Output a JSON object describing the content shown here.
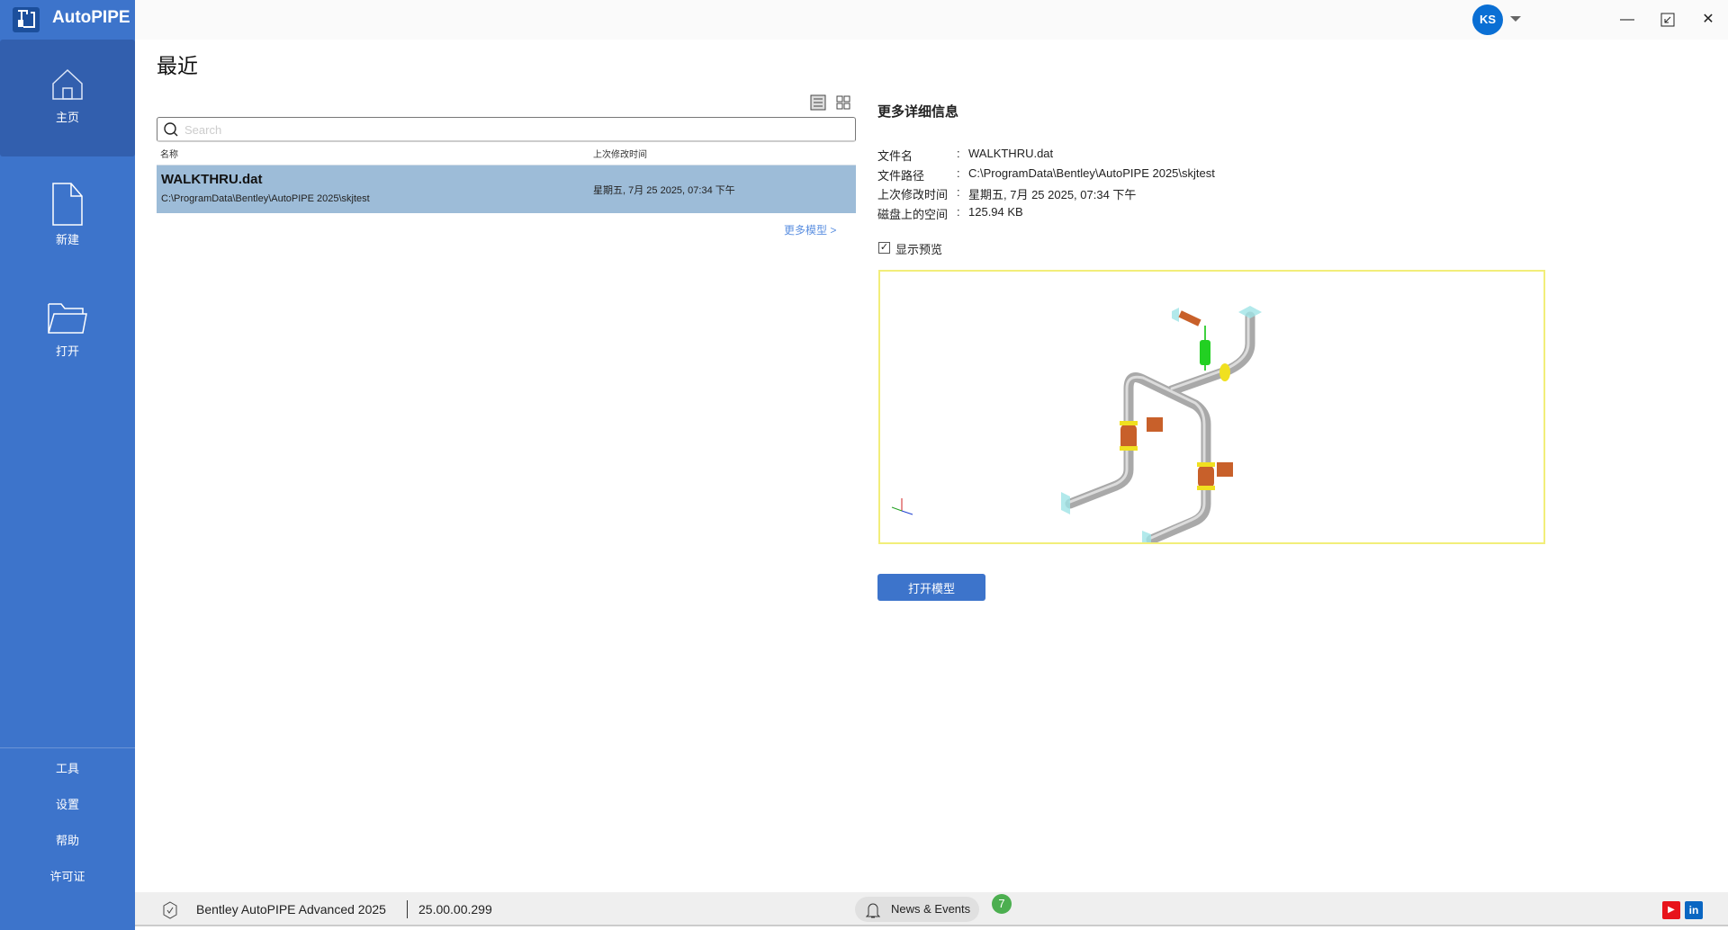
{
  "app": {
    "title": "AutoPIPE"
  },
  "sidebar": {
    "items": [
      {
        "label": "主页",
        "icon": "home-icon"
      },
      {
        "label": "新建",
        "icon": "new-file-icon"
      },
      {
        "label": "打开",
        "icon": "folder-icon"
      }
    ],
    "bottom": [
      "工具",
      "设置",
      "帮助",
      "许可证"
    ]
  },
  "user": {
    "initials": "KS"
  },
  "recent": {
    "title": "最近",
    "search_placeholder": "Search",
    "col_name": "名称",
    "col_modified": "上次修改时间",
    "files": [
      {
        "name": "WALKTHRU.dat",
        "path": "C:\\ProgramData\\Bentley\\AutoPIPE 2025\\skjtest",
        "modified": "星期五, 7月 25 2025, 07:34 下午"
      }
    ],
    "more_label": "更多模型 >"
  },
  "details": {
    "title": "更多详细信息",
    "rows": [
      {
        "key": "文件名",
        "value": "WALKTHRU.dat"
      },
      {
        "key": "文件路径",
        "value": "C:\\ProgramData\\Bentley\\AutoPIPE 2025\\skjtest"
      },
      {
        "key": "上次修改时间",
        "value": "星期五, 7月 25 2025, 07:34 下午"
      },
      {
        "key": "磁盘上的空间",
        "value": "125.94 KB"
      }
    ],
    "separator": ":",
    "show_preview_label": "显示预览",
    "show_preview": true,
    "open_button": "打开模型"
  },
  "status": {
    "product": "Bentley AutoPIPE Advanced 2025",
    "version": "25.00.00.299",
    "news_label": "News & Events",
    "news_count": "7",
    "youtube": "▶",
    "linkedin": "in"
  },
  "colors": {
    "sidebar": "#3d74cb",
    "accent": "#0a6fd4",
    "selected_row": "#9dbcd8"
  }
}
